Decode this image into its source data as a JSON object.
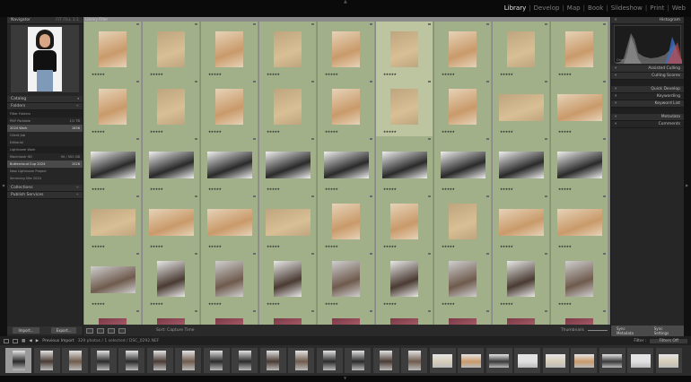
{
  "modules": [
    "Library",
    "Develop",
    "Map",
    "Book",
    "Slideshow",
    "Print",
    "Web"
  ],
  "active_module": "Library",
  "left_panel": {
    "navigator": "Navigator",
    "nav_opts": "FIT FILL 1:1",
    "catalog": "Catalog",
    "folders": "Folders",
    "folder_rows": [
      {
        "label": "Filter Folders",
        "count": "",
        "sel": false,
        "dark": true
      },
      {
        "label": "PNY Portable",
        "count": "1/1 TB",
        "sel": false,
        "dark": false
      },
      {
        "label": "2024 Work",
        "count": "1836",
        "sel": true,
        "dark": false
      },
      {
        "label": "Client Job",
        "count": "",
        "sel": false,
        "dark": false
      },
      {
        "label": "Editorial",
        "count": "",
        "sel": false,
        "dark": false
      },
      {
        "label": "Lightroom Work",
        "count": "",
        "sel": false,
        "dark": true
      },
      {
        "label": "Macintosh HD",
        "count": "90 / 500 GB",
        "sel": false,
        "dark": false
      },
      {
        "label": "Buttercloud Cup 2024",
        "count": "1026",
        "sel": true,
        "dark": false
      },
      {
        "label": "New Lightroom Project",
        "count": "",
        "sel": false,
        "dark": false
      },
      {
        "label": "Servicing Site 2024",
        "count": "",
        "sel": false,
        "dark": false
      }
    ],
    "collections": "Collections",
    "publish": "Publish Services",
    "import": "Import...",
    "export": "Export..."
  },
  "right_panel": {
    "histogram": "Histogram",
    "original_photo": "Original Photo",
    "sections": [
      {
        "label": "Assisted Culling",
        "dark": false
      },
      {
        "label": "Culling Scores",
        "dark": false
      },
      {
        "label": "Quick Develop",
        "dark": false
      },
      {
        "label": "Keywording",
        "dark": true
      },
      {
        "label": "Keyword List",
        "dark": false
      },
      {
        "label": "Metadata",
        "dark": false
      },
      {
        "label": "Comments",
        "dark": true
      }
    ],
    "sync_metadata": "Sync Metadata",
    "sync_settings": "Sync Settings"
  },
  "grid": {
    "title": "Library Filter"
  },
  "toolbar": {
    "sort": "Sort: Capture Time",
    "thumbnails": "Thumbnails"
  },
  "filmstrip": {
    "source": "Previous Import",
    "info": "329 photos / 1 selected / DSC_0292.NEF",
    "filter": "Filter :",
    "filter_value": "Filters Off"
  },
  "colors": {
    "accent": "#e6e6e6",
    "pick_bg": "#a2b089",
    "grid_bg": "#8a8a8a"
  }
}
